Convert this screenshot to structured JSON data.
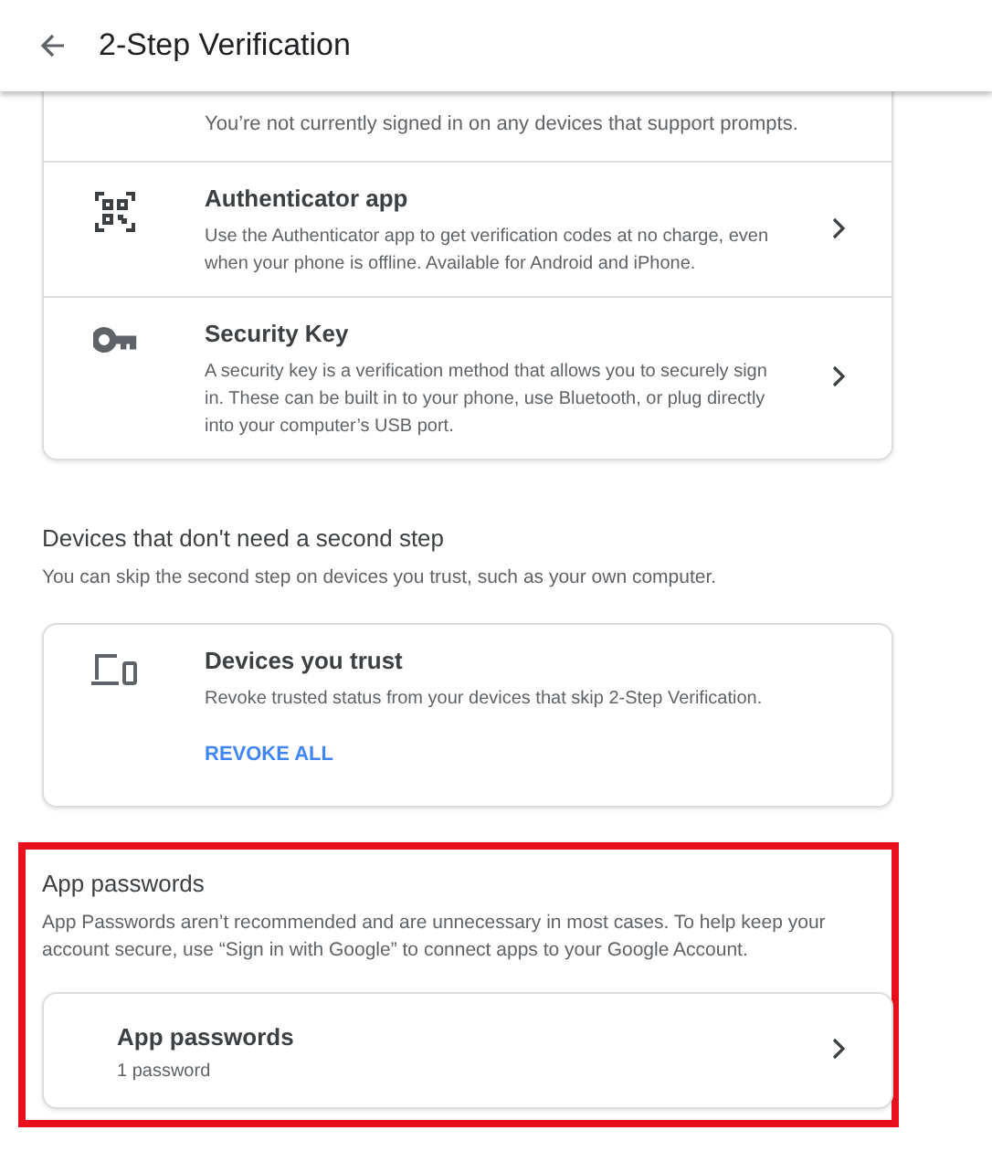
{
  "header": {
    "title": "2-Step Verification"
  },
  "prompt_card": {
    "note": "You’re not currently signed in on any devices that support prompts.",
    "options": [
      {
        "kind": "qr",
        "title": "Authenticator app",
        "description": "Use the Authenticator app to get verification codes at no charge, even when your phone is offline. Available for Android and iPhone.",
        "chevron": true
      },
      {
        "kind": "key",
        "title": "Security Key",
        "description": "A security key is a verification method that allows you to securely sign in. These can be built in to your phone, use Bluetooth, or plug directly into your computer’s USB port.",
        "chevron": true
      }
    ]
  },
  "sections": [
    {
      "heading": "Devices that don't need a second step",
      "description": "You can skip the second step on devices you trust, such as your own computer.",
      "highlighted": false,
      "card": {
        "kind": "devices",
        "title": "Devices you trust",
        "description": "Revoke trusted status from your devices that skip 2-Step Verification.",
        "action": "REVOKE ALL",
        "chevron": false
      }
    },
    {
      "heading": "App passwords",
      "description": "App Passwords aren’t recommended and are unnecessary in most cases. To help keep your account secure, use “Sign in with Google” to connect apps to your Google Account.",
      "highlighted": true,
      "card": {
        "kind": "plain",
        "title": "App passwords",
        "subtitle": "1 password",
        "chevron": true
      }
    }
  ]
}
